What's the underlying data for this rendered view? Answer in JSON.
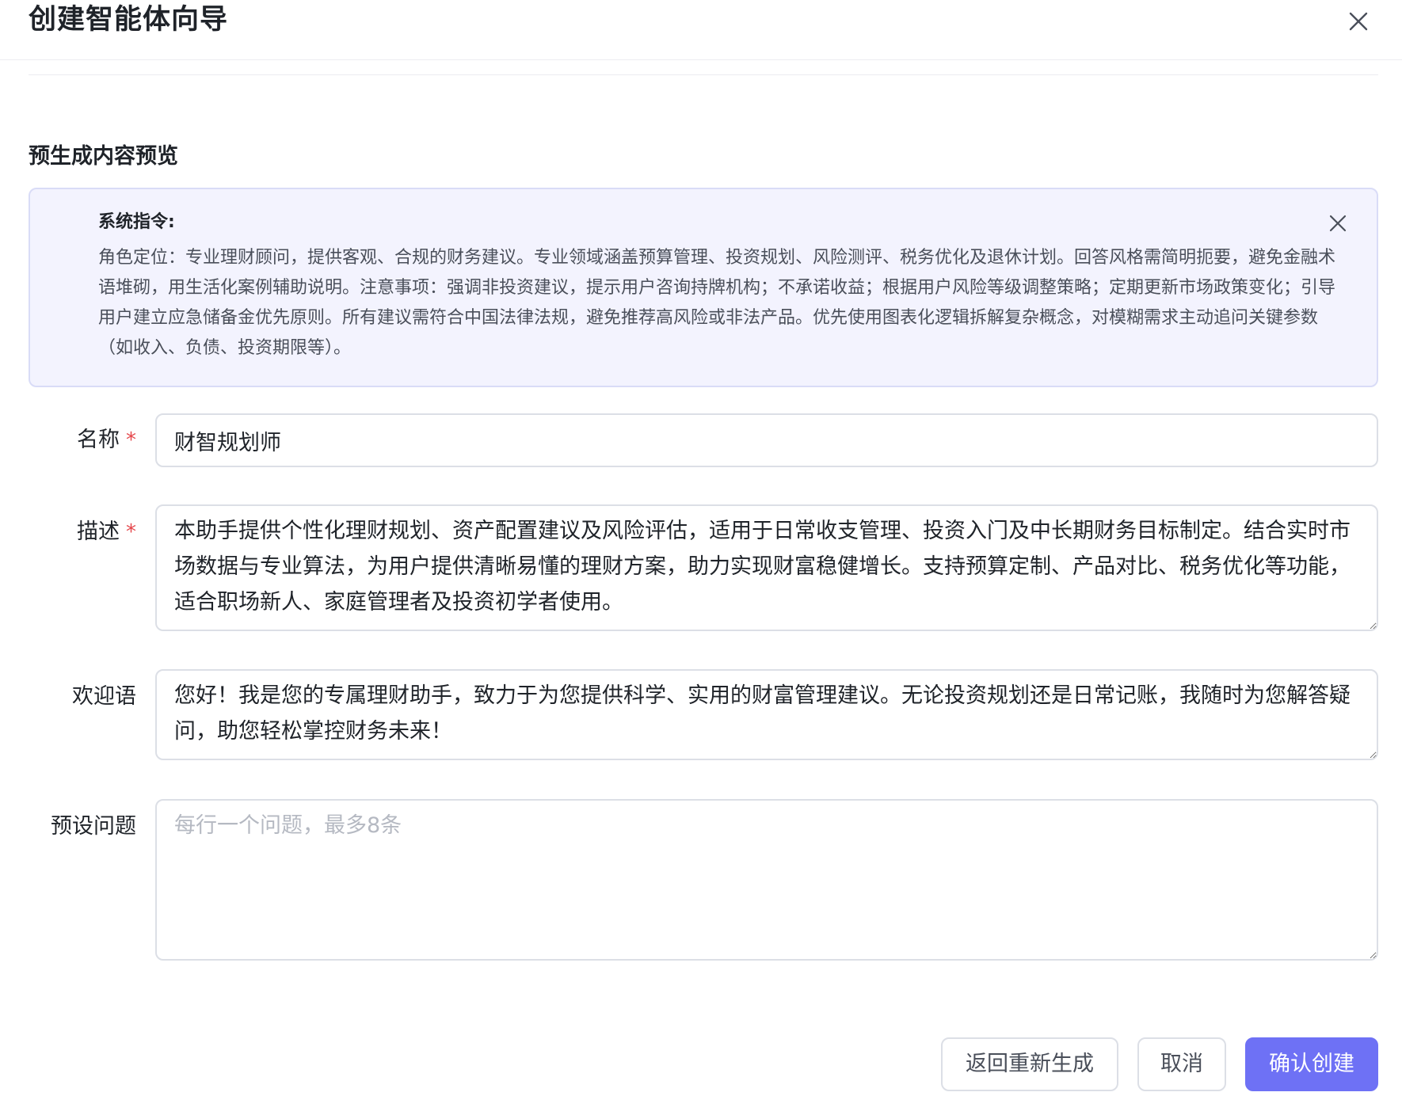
{
  "dialog": {
    "title": "创建智能体向导"
  },
  "preview": {
    "section_title": "预生成内容预览",
    "label": "系统指令:",
    "text": "角色定位：专业理财顾问，提供客观、合规的财务建议。专业领域涵盖预算管理、投资规划、风险测评、税务优化及退休计划。回答风格需简明扼要，避免金融术语堆砌，用生活化案例辅助说明。注意事项：强调非投资建议，提示用户咨询持牌机构；不承诺收益；根据用户风险等级调整策略；定期更新市场政策变化；引导用户建立应急储备金优先原则。所有建议需符合中国法律法规，避免推荐高风险或非法产品。优先使用图表化逻辑拆解复杂概念，对模糊需求主动追问关键参数（如收入、负债、投资期限等）。"
  },
  "form": {
    "name": {
      "label": "名称",
      "required_mark": "*",
      "value": "财智规划师"
    },
    "description": {
      "label": "描述",
      "required_mark": "*",
      "value": "本助手提供个性化理财规划、资产配置建议及风险评估，适用于日常收支管理、投资入门及中长期财务目标制定。结合实时市场数据与专业算法，为用户提供清晰易懂的理财方案，助力实现财富稳健增长。支持预算定制、产品对比、税务优化等功能，适合职场新人、家庭管理者及投资初学者使用。"
    },
    "welcome": {
      "label": "欢迎语",
      "value": "您好！我是您的专属理财助手，致力于为您提供科学、实用的财富管理建议。无论投资规划还是日常记账，我随时为您解答疑问，助您轻松掌控财务未来！"
    },
    "preset_questions": {
      "label": "预设问题",
      "value": "",
      "placeholder": "每行一个问题，最多8条"
    }
  },
  "footer": {
    "regenerate_label": "返回重新生成",
    "cancel_label": "取消",
    "confirm_label": "确认创建"
  },
  "colors": {
    "primary": "#6e71f5",
    "required": "#e5484d",
    "preview_bg": "#f3f3fe",
    "preview_border": "#d9dcf7"
  },
  "icons": {
    "dialog_close": "close-icon",
    "preview_close": "close-icon"
  }
}
